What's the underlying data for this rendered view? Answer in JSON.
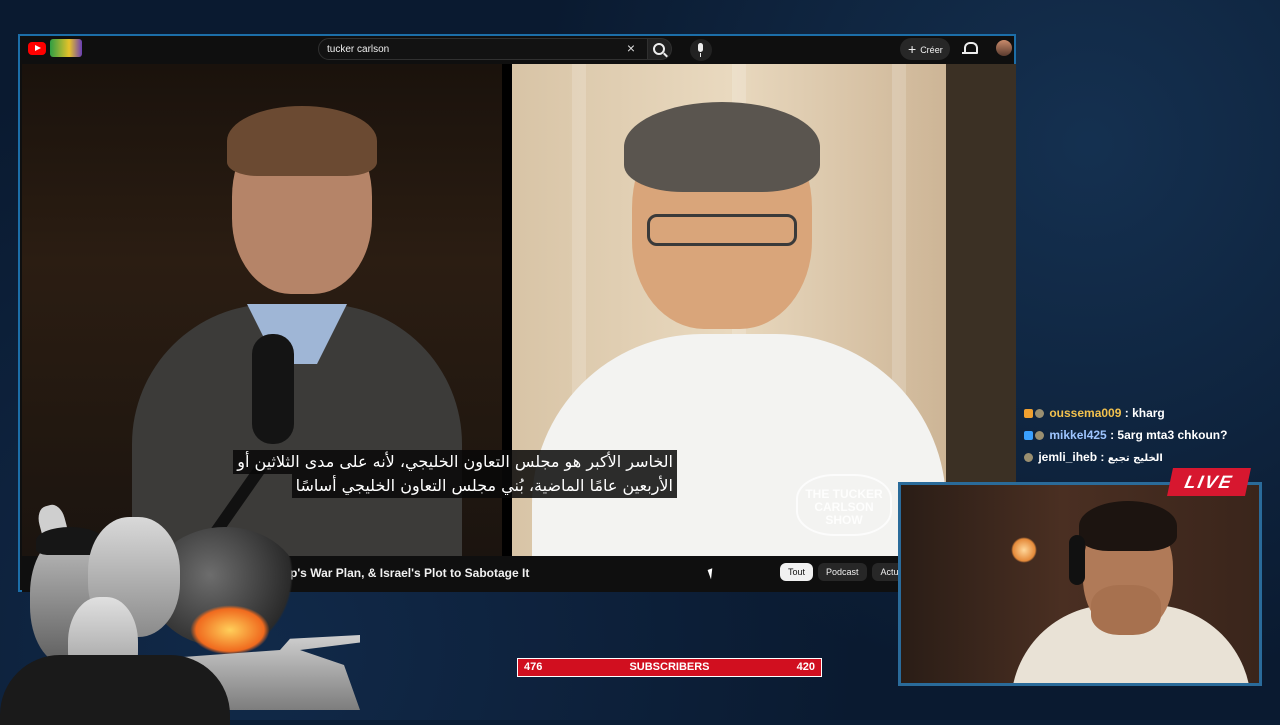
{
  "youtube": {
    "search": {
      "query": "tucker carlson"
    },
    "header": {
      "create_label": "Créer"
    },
    "video": {
      "subtitle_line1": "الخاسر الأكبر هو مجلس التعاون الخليجي، لأنه على مدى الثلاثين أو",
      "subtitle_line2": "الأربعين عامًا الماضية، بُني مجلس التعاون الخليجي أساسًا",
      "watermark": "THE TUCKER CARLSON SHOW",
      "title": "ump's War Plan, & Israel's Plot to Sabotage It"
    },
    "chips": [
      {
        "label": "Tout",
        "active": true
      },
      {
        "label": "Podcast",
        "active": false
      },
      {
        "label": "Actual",
        "active": false
      }
    ]
  },
  "chat": [
    {
      "user": "oussema009",
      "sep": ":",
      "message": "kharg",
      "color": "#f2c14e"
    },
    {
      "user": "mikkel425",
      "sep": ":",
      "message": "5arg mta3 chkoun?",
      "color": "#9ec5ff"
    },
    {
      "user": "jemli_iheb",
      "sep": ":",
      "message": "الخليج تجبع",
      "color": "#ffffff"
    }
  ],
  "overlay": {
    "live_label": "LIVE",
    "subscribers": {
      "left": "476",
      "label": "SUBSCRIBERS",
      "right": "420"
    }
  },
  "colors": {
    "accent_blue": "#1c6ea8",
    "live_red": "#d7172f",
    "youtube_red": "#ff0000"
  }
}
